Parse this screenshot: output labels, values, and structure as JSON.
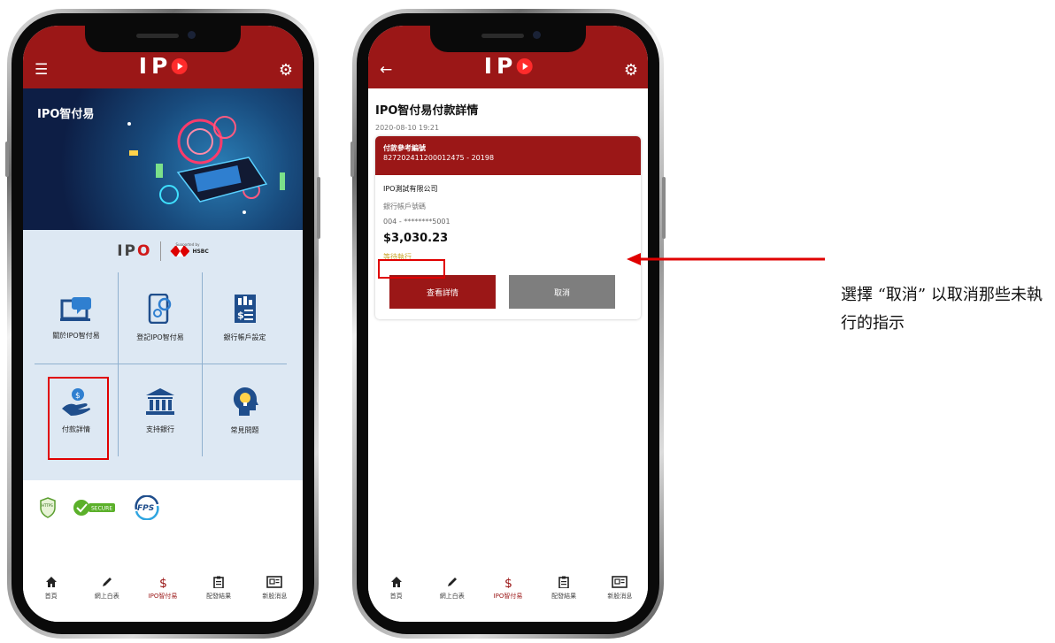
{
  "phone1": {
    "header_logo": "IP",
    "banner_title": "IPO智付易",
    "brand_ipo": "IP",
    "brand_supported": "Supported by",
    "brand_hsbc": "HSBC",
    "tiles": [
      {
        "label": "關於IPO智付易",
        "icon": "about-icon"
      },
      {
        "label": "登記IPO智付易",
        "icon": "register-icon"
      },
      {
        "label": "銀行帳戶設定",
        "icon": "bank-account-icon"
      },
      {
        "label": "付款詳情",
        "icon": "payment-icon"
      },
      {
        "label": "支持銀行",
        "icon": "bank-icon"
      },
      {
        "label": "常見問題",
        "icon": "faq-icon"
      }
    ],
    "security_badges": [
      "HTTPS",
      "SECURE",
      "FPS"
    ]
  },
  "phone2": {
    "header_logo": "IP",
    "title": "IPO智付易付款詳情",
    "timestamp": "2020-08-10 19:21",
    "ref_label": "付款參考編號",
    "ref_number": "827202411200012475 - 20198",
    "company": "IPO測試有限公司",
    "account_label": "銀行帳戶號碼",
    "account_number": "004 - ********5001",
    "amount": "$3,030.23",
    "status": "等待執行",
    "view_button": "查看詳情",
    "cancel_button": "取消"
  },
  "nav": [
    {
      "label": "首頁",
      "icon": "home-icon"
    },
    {
      "label": "網上白表",
      "icon": "pencil-icon"
    },
    {
      "label": "IPO智付易",
      "icon": "dollar-icon"
    },
    {
      "label": "配發結果",
      "icon": "clipboard-icon"
    },
    {
      "label": "新股消息",
      "icon": "newspaper-icon"
    }
  ],
  "annotation": "選擇 “取消” 以取消那些未執行的指示",
  "colors": {
    "brand_red": "#9b1717",
    "highlight_red": "#e00000",
    "status_amber": "#c9a227",
    "grid_bg": "#dde8f3"
  }
}
